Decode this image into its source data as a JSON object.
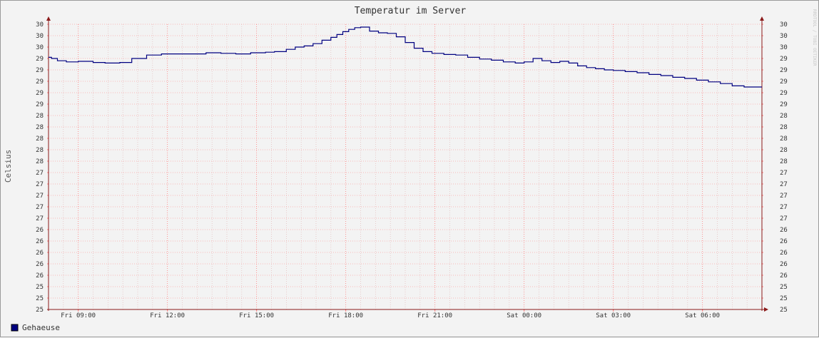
{
  "chart_data": {
    "type": "line",
    "title": "Temperatur im Server",
    "ylabel": "Celsius",
    "xlabel": "",
    "watermark": "RRDTOOL / TOBI OETIKER",
    "ylim": [
      25.0,
      30.0
    ],
    "y_ticks": [
      25.0,
      25.2,
      25.4,
      25.6,
      25.8,
      26.0,
      26.2,
      26.4,
      26.6,
      26.8,
      27.0,
      27.2,
      27.4,
      27.6,
      27.8,
      28.0,
      28.2,
      28.4,
      28.6,
      28.8,
      29.0,
      29.2,
      29.4,
      29.6,
      29.8,
      30.0
    ],
    "y_tick_labels": [
      "25",
      "25",
      "25",
      "26",
      "26",
      "26",
      "26",
      "26",
      "27",
      "27",
      "27",
      "27",
      "27",
      "28",
      "28",
      "28",
      "28",
      "28",
      "29",
      "29",
      "29",
      "29",
      "29",
      "30",
      "30",
      "30"
    ],
    "xlim_hours": [
      8.0,
      32.0
    ],
    "x_tick_hours": [
      9,
      12,
      15,
      18,
      21,
      24,
      27,
      30
    ],
    "x_tick_labels": [
      "Fri 09:00",
      "Fri 12:00",
      "Fri 15:00",
      "Fri 18:00",
      "Fri 21:00",
      "Sat 00:00",
      "Sat 03:00",
      "Sat 06:00"
    ],
    "grid": true,
    "legend_position": "bottom-left",
    "colors": {
      "line": "#000080",
      "grid_major": "#ff8080",
      "grid_minor": "#e0b0b0",
      "axis": "#8b1a1a"
    },
    "series": [
      {
        "name": "Gehaeuse",
        "color": "#000080",
        "x": [
          8.0,
          8.1,
          8.3,
          8.6,
          9.0,
          9.5,
          9.9,
          10.4,
          10.8,
          11.3,
          11.8,
          12.3,
          12.8,
          13.3,
          13.8,
          14.3,
          14.8,
          15.3,
          15.6,
          16.0,
          16.3,
          16.6,
          16.9,
          17.2,
          17.5,
          17.7,
          17.9,
          18.1,
          18.3,
          18.5,
          18.8,
          19.1,
          19.4,
          19.7,
          20.0,
          20.3,
          20.6,
          20.9,
          21.3,
          21.7,
          22.1,
          22.5,
          22.9,
          23.3,
          23.7,
          24.0,
          24.3,
          24.6,
          24.9,
          25.2,
          25.5,
          25.8,
          26.1,
          26.4,
          26.7,
          27.0,
          27.4,
          27.8,
          28.2,
          28.6,
          29.0,
          29.4,
          29.8,
          30.2,
          30.6,
          31.0,
          31.4,
          31.7,
          32.0
        ],
        "values": [
          29.42,
          29.4,
          29.36,
          29.34,
          29.35,
          29.33,
          29.32,
          29.33,
          29.4,
          29.46,
          29.48,
          29.48,
          29.48,
          29.5,
          29.49,
          29.48,
          29.5,
          29.51,
          29.52,
          29.56,
          29.6,
          29.62,
          29.66,
          29.72,
          29.77,
          29.82,
          29.87,
          29.91,
          29.94,
          29.95,
          29.88,
          29.85,
          29.84,
          29.78,
          29.68,
          29.58,
          29.52,
          29.49,
          29.47,
          29.46,
          29.42,
          29.39,
          29.37,
          29.34,
          29.32,
          29.34,
          29.4,
          29.36,
          29.33,
          29.35,
          29.32,
          29.27,
          29.24,
          29.22,
          29.2,
          29.19,
          29.17,
          29.15,
          29.12,
          29.1,
          29.07,
          29.05,
          29.02,
          28.99,
          28.96,
          28.92,
          28.9,
          28.9,
          28.9
        ]
      }
    ]
  }
}
